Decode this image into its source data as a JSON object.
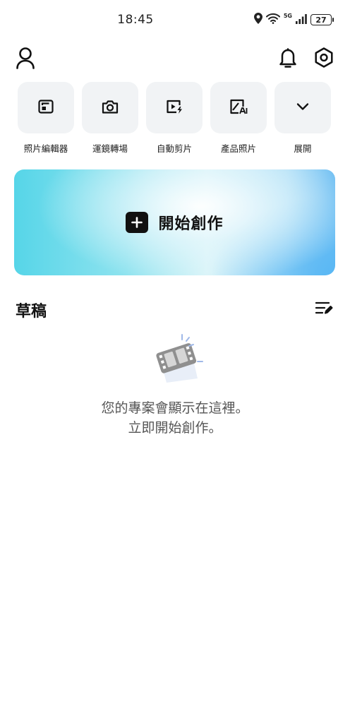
{
  "status_bar": {
    "time": "18:45",
    "network": "5G",
    "battery": "27"
  },
  "top_bar": {
    "profile_icon": "user-icon",
    "notifications_icon": "bell-icon",
    "settings_icon": "settings-hexagon-icon"
  },
  "tools": [
    {
      "label": "照片編輯器",
      "icon": "photo-editor-icon"
    },
    {
      "label": "運鏡轉場",
      "icon": "camera-icon"
    },
    {
      "label": "自動剪片",
      "icon": "auto-cut-icon"
    },
    {
      "label": "產品照片",
      "icon": "ai-product-photo-icon"
    },
    {
      "label": "展開",
      "icon": "chevron-down-icon"
    }
  ],
  "create": {
    "label": "開始創作",
    "icon": "plus-icon"
  },
  "drafts": {
    "title": "草稿",
    "manage_icon": "edit-list-icon",
    "empty_line1": "您的專案會顯示在這裡。",
    "empty_line2": "立即開始創作。"
  },
  "colors": {
    "banner_cyan": "#56d5e8",
    "banner_blue": "#5ab8f4",
    "tile_bg": "#f1f3f5",
    "text_primary": "#111111",
    "text_secondary": "#555555"
  }
}
